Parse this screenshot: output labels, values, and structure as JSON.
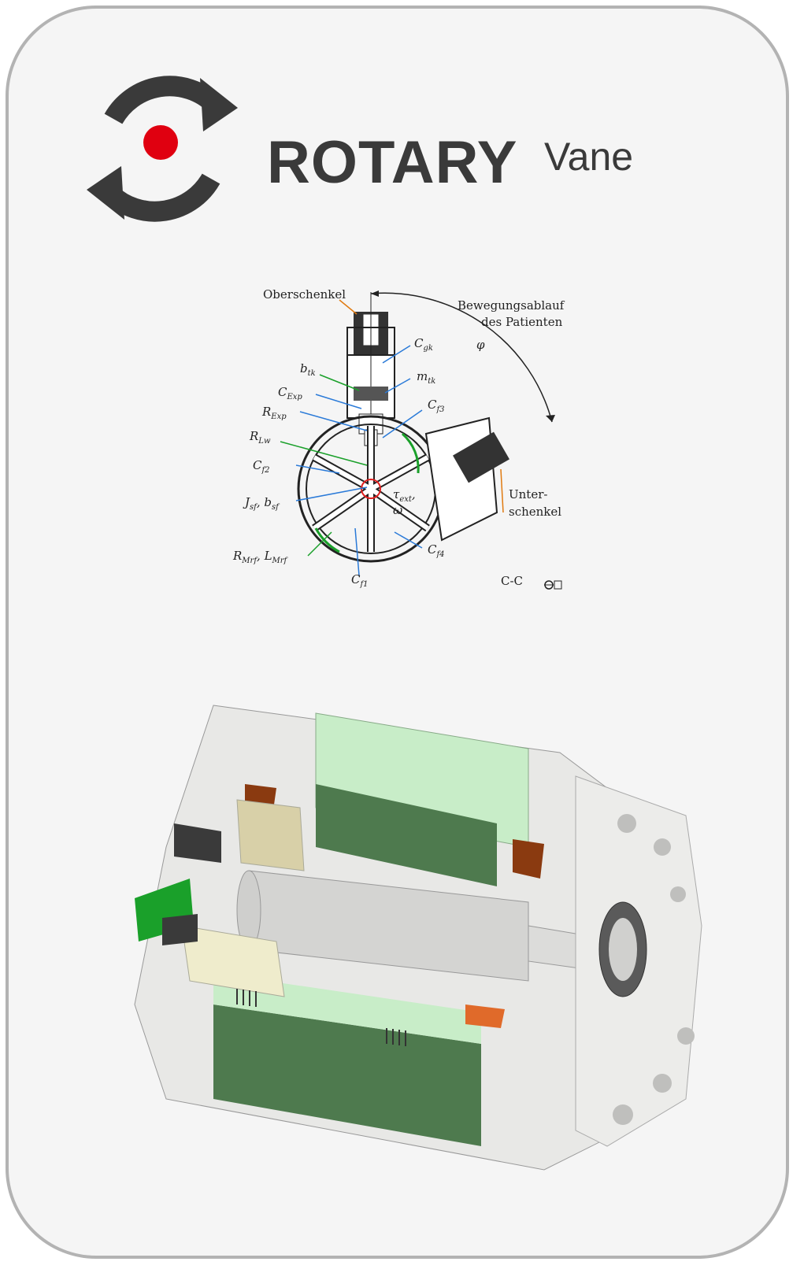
{
  "brand": {
    "name": "ROTARY",
    "suffix": "Vane"
  },
  "colors": {
    "logo_dark": "#3a3a3a",
    "logo_dot": "#e00010",
    "card_border": "#b3b3b3",
    "housing_green": "#4e7a4e",
    "housing_light": "#c8edc8",
    "coil_orange": "#e06a2a",
    "pcb_green": "#1aa02a"
  },
  "diagram": {
    "labels": {
      "oberschenkel": "Oberschenkel",
      "bewegung_1": "Bewegungsablauf",
      "bewegung_2": "des Patienten",
      "phi": "φ",
      "c_gk": "C",
      "c_gk_sub": "gk",
      "b_tk": "b",
      "b_tk_sub": "tk",
      "m_tk": "m",
      "m_tk_sub": "tk",
      "c_exp": "C",
      "c_exp_sub": "Exp",
      "r_exp": "R",
      "r_exp_sub": "Exp",
      "c_f3": "C",
      "c_f3_sub": "f3",
      "r_lw": "R",
      "r_lw_sub": "Lw",
      "c_f2": "C",
      "c_f2_sub": "f2",
      "j_sf": "J",
      "j_sf_sub": "sf",
      "b_sf": ", b",
      "b_sf_sub": "sf",
      "tau": "τ",
      "tau_sub": "ext",
      "omega": "ω",
      "r_mrf": "R",
      "r_mrf_sub": "Mrf",
      "l_mrf": ", L",
      "l_mrf_sub": "Mrf",
      "c_f1": "C",
      "c_f1_sub": "f1",
      "c_f4": "C",
      "c_f4_sub": "f4",
      "unter_1": "Unter-",
      "unter_2": "schenkel",
      "section": "C-C"
    }
  }
}
